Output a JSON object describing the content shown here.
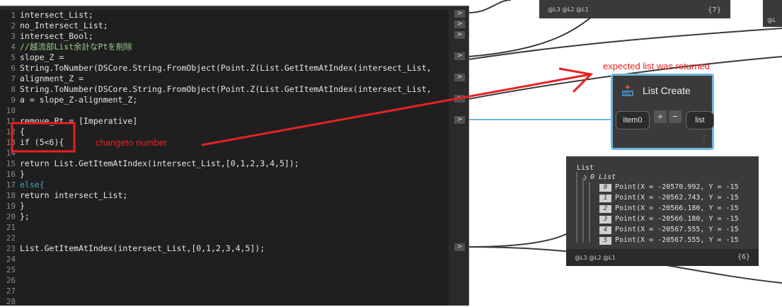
{
  "code_block": {
    "lines": [
      {
        "n": "1",
        "text": "intersect_List;"
      },
      {
        "n": "2",
        "text": "no_Intersect_List;"
      },
      {
        "n": "3",
        "text": "intersect_Bool;"
      },
      {
        "n": "4",
        "text": "//越流部List余計なPtを削除"
      },
      {
        "n": "5",
        "text": "slope_Z ="
      },
      {
        "n": "6",
        "text": "String.ToNumber(DSCore.String.FromObject(Point.Z(List.GetItemAtIndex(intersect_List,"
      },
      {
        "n": "7",
        "text": "alignment_Z ="
      },
      {
        "n": "8",
        "text": "String.ToNumber(DSCore.String.FromObject(Point.Z(List.GetItemAtIndex(intersect_List,"
      },
      {
        "n": "9",
        "text": "a = slope_Z-alignment_Z;"
      },
      {
        "n": "10",
        "text": ""
      },
      {
        "n": "11",
        "text": "remove_Pt = [Imperative]"
      },
      {
        "n": "12",
        "text": "{"
      },
      {
        "n": "13",
        "text": "if (5<6){"
      },
      {
        "n": "14",
        "text": ""
      },
      {
        "n": "15",
        "text": "return List.GetItemAtIndex(intersect_List,[0,1,2,3,4,5]);"
      },
      {
        "n": "16",
        "text": "}"
      },
      {
        "n": "17",
        "text": "else{"
      },
      {
        "n": "18",
        "text": "return intersect_List;"
      },
      {
        "n": "19",
        "text": "}"
      },
      {
        "n": "20",
        "text": "};"
      },
      {
        "n": "21",
        "text": ""
      },
      {
        "n": "22",
        "text": ""
      },
      {
        "n": "23",
        "text": "List.GetItemAtIndex(intersect_List,[0,1,2,3,4,5]);"
      },
      {
        "n": "24",
        "text": ""
      },
      {
        "n": "25",
        "text": ""
      },
      {
        "n": "26",
        "text": ""
      },
      {
        "n": "27",
        "text": ""
      },
      {
        "n": "28",
        "text": ""
      }
    ],
    "port_arrow": ">"
  },
  "top_node": {
    "levels": "@L3 @L2 @L1",
    "count": "{7}"
  },
  "list_create": {
    "title": "List Create",
    "input_port": "item0",
    "add_label": "+",
    "remove_label": "−",
    "output_port": "list",
    "menu": "⋮"
  },
  "watch": {
    "header": "List",
    "sub": "0 List",
    "items": [
      {
        "idx": "0",
        "text": "Point(X = -20570.992, Y = -15"
      },
      {
        "idx": "1",
        "text": "Point(X = -20562.743, Y = -15"
      },
      {
        "idx": "2",
        "text": "Point(X = -20566.180, Y = -15"
      },
      {
        "idx": "3",
        "text": "Point(X = -20566.180, Y = -15"
      },
      {
        "idx": "4",
        "text": "Point(X = -20567.555, Y = -15"
      },
      {
        "idx": "5",
        "text": "Point(X = -20567.555, Y = -15"
      }
    ],
    "levels": "@L3 @L2 @L1",
    "count": "{6}"
  },
  "annotations": {
    "change_label": "changeto number",
    "returned_label": "expected list was returned"
  },
  "colors": {
    "annotation_red": "#e52222",
    "wire_blue": "#6fb6df",
    "wire_dark": "#3a3a3a"
  }
}
